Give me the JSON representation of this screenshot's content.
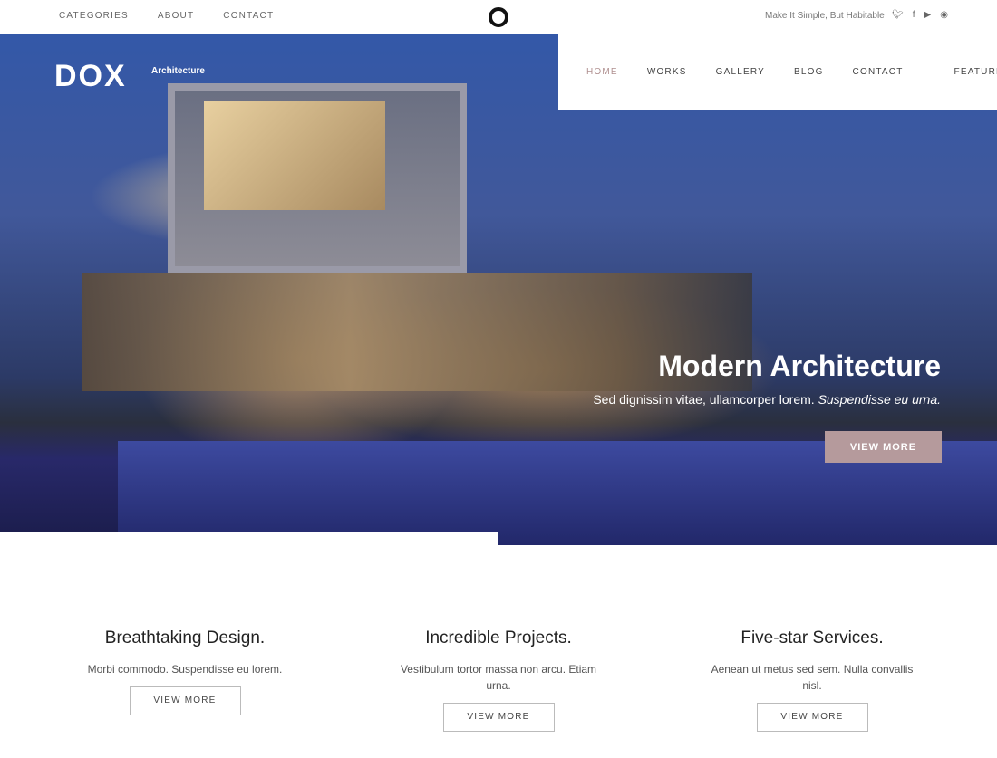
{
  "topbar": {
    "nav": [
      "CATEGORIES",
      "ABOUT",
      "CONTACT"
    ],
    "tagline": "Make It Simple, But Habitable",
    "social": [
      "twitter-icon",
      "facebook-icon",
      "youtube-icon",
      "spotify-icon"
    ]
  },
  "brand": {
    "logo": "DOX",
    "sub": "Architecture"
  },
  "mainnav": {
    "items": [
      "HOME",
      "WORKS",
      "GALLERY",
      "BLOG",
      "CONTACT"
    ],
    "features": "FEATURES",
    "active": "HOME"
  },
  "hero": {
    "title": "Modern Architecture",
    "subtitle": "Sed dignissim vitae, ullamcorper lorem.",
    "subtitle_italic": "Suspendisse eu urna.",
    "button": "VIEW MORE"
  },
  "features": [
    {
      "title": "Breathtaking Design.",
      "text": "Morbi commodo. Suspendisse eu lorem.",
      "button": "VIEW MORE"
    },
    {
      "title": "Incredible Projects.",
      "text": "Vestibulum tortor massa non arcu. Etiam urna.",
      "button": "VIEW MORE"
    },
    {
      "title": "Five-star Services.",
      "text": "Aenean ut metus sed sem. Nulla convallis nisl.",
      "button": "VIEW MORE"
    }
  ],
  "colors": {
    "accent": "#b59a9c"
  }
}
